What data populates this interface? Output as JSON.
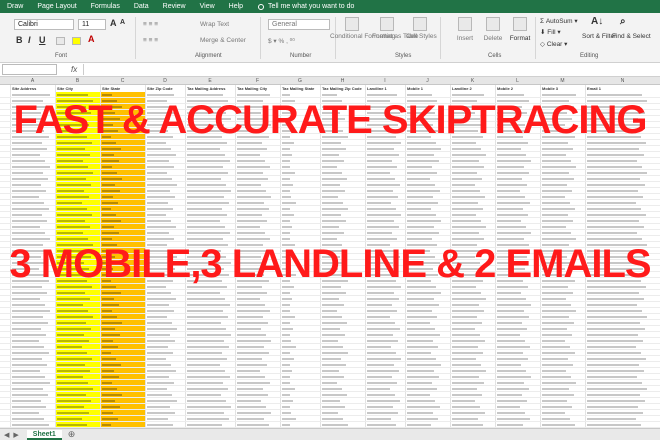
{
  "ribbon_tabs": [
    "Draw",
    "Page Layout",
    "Formulas",
    "Data",
    "Review",
    "View",
    "Help"
  ],
  "tell_me": "Tell me what you want to do",
  "font": {
    "name": "Calibri",
    "size": "11"
  },
  "ribbon": {
    "wrap_text": "Wrap Text",
    "merge_center": "Merge & Center",
    "number_format": "General",
    "conditional_formatting": "Conditional Formatting",
    "format_as_table": "Format as Table",
    "cell_styles": "Cell Styles",
    "insert": "Insert",
    "delete": "Delete",
    "format": "Format",
    "autosum": "AutoSum",
    "fill": "Fill",
    "clear": "Clear",
    "sort_filter": "Sort & Filter",
    "find_select": "Find & Select",
    "groups": [
      "Font",
      "Alignment",
      "Number",
      "Styles",
      "Cells",
      "Editing"
    ]
  },
  "formula_bar": {
    "fx": "fx"
  },
  "columns": [
    "A",
    "B",
    "C",
    "D",
    "E",
    "F",
    "G",
    "H",
    "I",
    "J",
    "K",
    "L",
    "M",
    "N"
  ],
  "header_row": [
    "Site Address",
    "Site City",
    "Site State",
    "Site Zip Code",
    "Tax Mailing Address",
    "Tax Mailing City",
    "Tax Mailing State",
    "Tax Mailing Zip Code",
    "Landline 1",
    "Mobile 1",
    "Landline 2",
    "Mobile 2",
    "Mobile 3",
    "Email 1"
  ],
  "headline_1": "FAST & ACCURATE SKIPTRACING",
  "headline_2": "3 MOBILE,3 LANDLINE & 2 EMAILS",
  "sheet_tab": "Sheet1",
  "colors": {
    "excel_green": "#217346",
    "headline_red": "#ff1a1a",
    "city_highlight": "#ffff00",
    "state_highlight": "#ffc000"
  }
}
